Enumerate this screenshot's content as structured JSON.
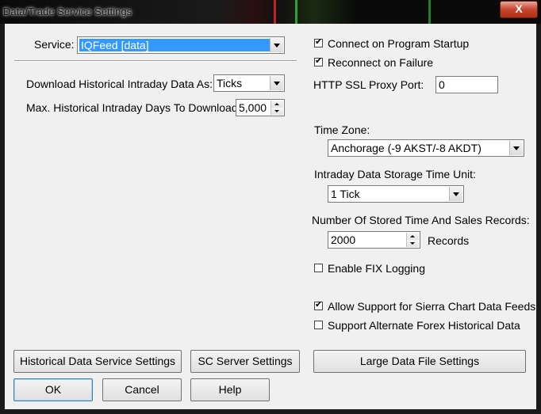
{
  "window": {
    "title": "Data/Trade Service Settings",
    "close_glyph": "X"
  },
  "service": {
    "label": "Service:",
    "value": "IQFeed   [data]"
  },
  "download_as": {
    "label": "Download Historical Intraday Data As:",
    "value": "Ticks"
  },
  "max_days": {
    "label": "Max. Historical Intraday Days To Download:",
    "value": "5,000"
  },
  "connect_startup": {
    "label": "Connect on Program Startup",
    "checked": true
  },
  "reconnect_failure": {
    "label": "Reconnect on Failure",
    "checked": true
  },
  "proxy_port": {
    "label": "HTTP SSL Proxy Port:",
    "value": "0"
  },
  "time_zone": {
    "label": "Time Zone:",
    "value": "Anchorage (-9 AKST/-8 AKDT)"
  },
  "storage_unit": {
    "label": "Intraday Data Storage Time Unit:",
    "value": "1 Tick"
  },
  "ts_records": {
    "label": "Number Of Stored Time And Sales Records:",
    "value": "2000",
    "suffix": "Records"
  },
  "fix_logging": {
    "label": "Enable FIX Logging",
    "checked": false
  },
  "sierra_feeds": {
    "label": "Allow Support for Sierra Chart Data Feeds",
    "checked": true
  },
  "alt_forex": {
    "label": "Support Alternate Forex Historical Data",
    "checked": false
  },
  "buttons": {
    "historical": "Historical Data Service Settings",
    "sc_server": "SC Server Settings",
    "large_file": "Large Data File Settings",
    "ok": "OK",
    "cancel": "Cancel",
    "help": "Help"
  },
  "colors": {
    "selection": "#3399ff",
    "dialog_bg": "#f0f0f0",
    "close_button": "#c7432c"
  },
  "icons": {
    "close": "close-icon",
    "dropdown": "chevron-down-icon",
    "spin_up": "spin-up-icon",
    "spin_down": "spin-down-icon",
    "check": "check-icon"
  }
}
